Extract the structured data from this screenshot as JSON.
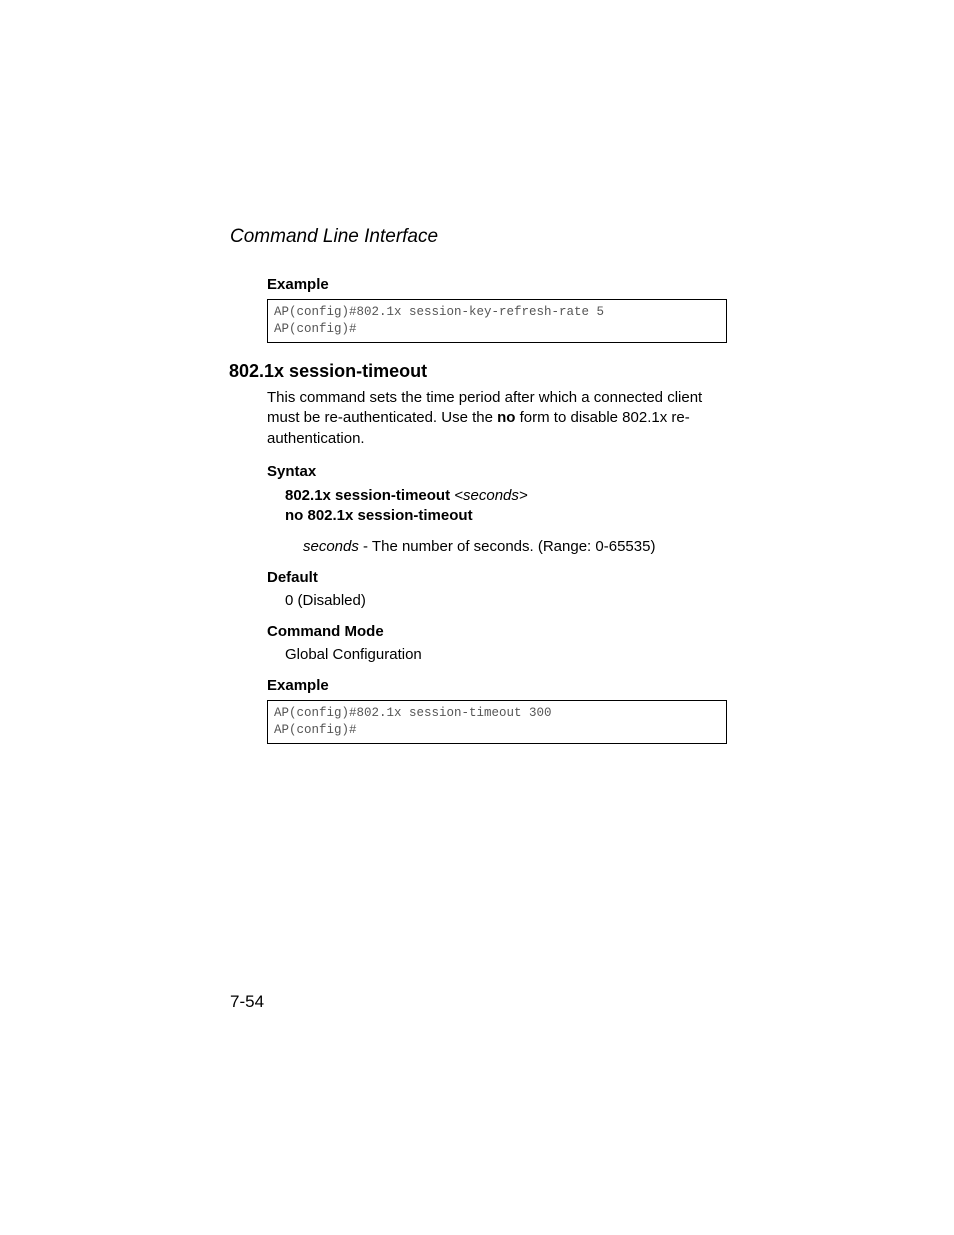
{
  "runningHead": "Command Line Interface",
  "block1": {
    "exampleLabel": "Example",
    "code": "AP(config)#802.1x session-key-refresh-rate 5\nAP(config)#"
  },
  "sectionHeading": "802.1x session-timeout",
  "block2": {
    "desc_pre": "This command sets the time period after which a connected client must be re-authenticated. Use the ",
    "desc_bold": "no",
    "desc_post": " form to disable 802.1x re-authentication.",
    "syntaxLabel": "Syntax",
    "syntax_cmd": "802.1x session-timeout",
    "syntax_arg": " <seconds>",
    "syntax_no": "no 802.1x session-timeout",
    "param_name": "seconds",
    "param_desc": " - The number of seconds. (Range: 0-65535)",
    "defaultLabel": "Default",
    "defaultVal": "0 (Disabled)",
    "modeLabel": "Command Mode",
    "modeVal": "Global Configuration",
    "exampleLabel": "Example",
    "code": "AP(config)#802.1x session-timeout 300\nAP(config)#"
  },
  "pageNumber": "7-54"
}
